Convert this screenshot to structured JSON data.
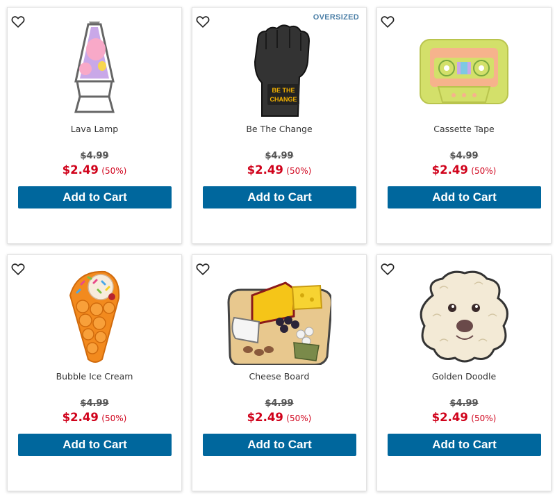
{
  "colors": {
    "accent": "#00679d",
    "sale": "#d0021b",
    "badge": "#4a7ea6"
  },
  "products": [
    {
      "name": "Lava Lamp",
      "badge": "",
      "original_price": "$4.99",
      "sale_price": "$2.49",
      "discount": "(50%)",
      "button": "Add to Cart",
      "icon": "lava-lamp-icon"
    },
    {
      "name": "Be The Change",
      "badge": "OVERSIZED",
      "original_price": "$4.99",
      "sale_price": "$2.49",
      "discount": "(50%)",
      "button": "Add to Cart",
      "icon": "raised-fist-icon",
      "image_text": "BE THE CHANGE"
    },
    {
      "name": "Cassette Tape",
      "badge": "",
      "original_price": "$4.99",
      "sale_price": "$2.49",
      "discount": "(50%)",
      "button": "Add to Cart",
      "icon": "cassette-tape-icon"
    },
    {
      "name": "Bubble Ice Cream",
      "badge": "",
      "original_price": "$4.99",
      "sale_price": "$2.49",
      "discount": "(50%)",
      "button": "Add to Cart",
      "icon": "bubble-ice-cream-icon"
    },
    {
      "name": "Cheese Board",
      "badge": "",
      "original_price": "$4.99",
      "sale_price": "$2.49",
      "discount": "(50%)",
      "button": "Add to Cart",
      "icon": "cheese-board-icon"
    },
    {
      "name": "Golden Doodle",
      "badge": "",
      "original_price": "$4.99",
      "sale_price": "$2.49",
      "discount": "(50%)",
      "button": "Add to Cart",
      "icon": "golden-doodle-icon"
    }
  ]
}
